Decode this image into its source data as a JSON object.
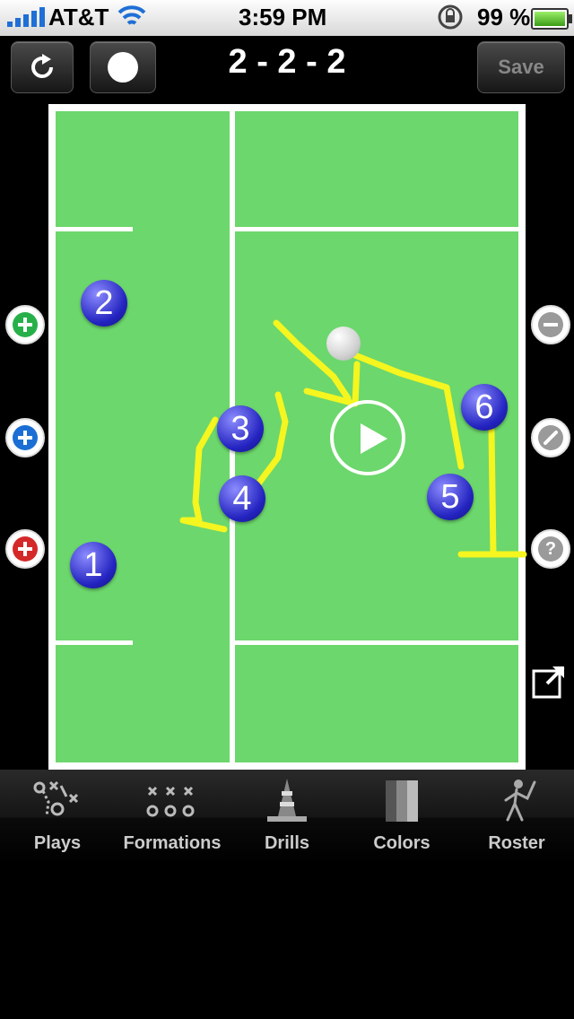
{
  "status_bar": {
    "carrier": "AT&T",
    "time": "3:59 PM",
    "battery_percent": "99 %"
  },
  "toolbar": {
    "title": "2 - 2 - 2",
    "save_label": "Save",
    "refresh_icon": "refresh-icon",
    "record_icon": "record-dot-icon"
  },
  "field": {
    "players": [
      {
        "number": "1"
      },
      {
        "number": "2"
      },
      {
        "number": "3"
      },
      {
        "number": "4"
      },
      {
        "number": "5"
      },
      {
        "number": "6"
      }
    ],
    "colors": {
      "grass": "#6cd76c",
      "lines": "#ffffff",
      "path": "#f5f51f",
      "player": "#2a2ad0"
    }
  },
  "side_buttons": {
    "left": [
      "add-green-icon",
      "add-blue-icon",
      "add-red-icon"
    ],
    "right": [
      "remove-icon",
      "pencil-icon",
      "help-icon",
      "share-icon"
    ]
  },
  "tabs": [
    {
      "label": "Plays",
      "icon": "plays-icon"
    },
    {
      "label": "Formations",
      "icon": "formations-icon"
    },
    {
      "label": "Drills",
      "icon": "cone-icon"
    },
    {
      "label": "Colors",
      "icon": "colors-icon"
    },
    {
      "label": "Roster",
      "icon": "player-icon"
    }
  ]
}
